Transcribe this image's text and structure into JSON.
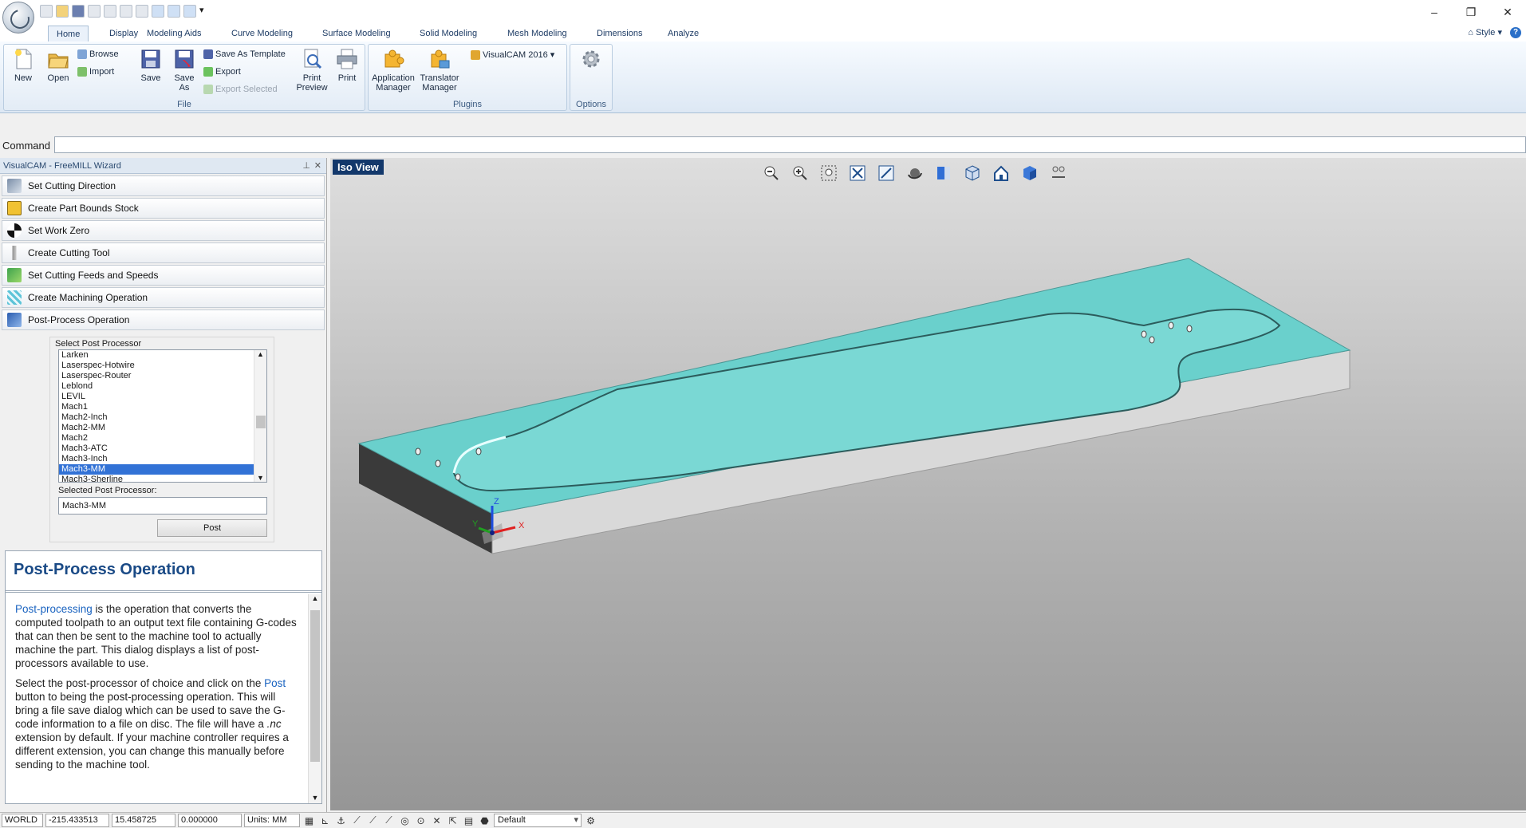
{
  "ribbon_tabs": [
    "Home",
    "Display",
    "Modeling Aids",
    "Curve Modeling",
    "Surface Modeling",
    "Solid Modeling",
    "Mesh Modeling",
    "Dimensions",
    "Analyze"
  ],
  "style_menu": "Style",
  "help_glyph": "?",
  "window_controls": {
    "minimize": "–",
    "restore": "❐",
    "close": "✕"
  },
  "file_group": {
    "label": "File",
    "new": "New",
    "open": "Open",
    "browse": "Browse",
    "import": "Import",
    "save": "Save",
    "save_as": "Save As",
    "save_as_template": "Save As Template",
    "export": "Export",
    "export_selected": "Export Selected",
    "print_preview": "Print Preview",
    "print": "Print"
  },
  "plugins_group": {
    "label": "Plugins",
    "application_manager": "Application Manager",
    "translator_manager": "Translator Manager",
    "visualcam": "VisualCAM 2016"
  },
  "options_group": {
    "label": "Options"
  },
  "command": {
    "label": "Command",
    "value": ""
  },
  "panel": {
    "title": "VisualCAM - FreeMILL Wizard",
    "pin_glyph": "⊥",
    "close_glyph": "✕",
    "wizard_items": [
      "Set Cutting Direction",
      "Create Part Bounds Stock",
      "Set Work Zero",
      "Create Cutting Tool",
      "Set Cutting Feeds and Speeds",
      "Create Machining Operation",
      "Post-Process Operation"
    ],
    "select_post_label": "Select Post Processor",
    "post_processors": [
      "Larken",
      "Laserspec-Hotwire",
      "Laserspec-Router",
      "Leblond",
      "LEVIL",
      "Mach1",
      "Mach2-Inch",
      "Mach2-MM",
      "Mach2",
      "Mach3-ATC",
      "Mach3-Inch",
      "Mach3-MM",
      "Mach3-Sherline"
    ],
    "selected_index": 11,
    "selected_label": "Selected Post Processor:",
    "selected_value": "Mach3-MM",
    "post_button": "Post"
  },
  "help": {
    "title": "Post-Process Operation",
    "p1_link": "Post-processing",
    "p1_text": " is the operation that converts the computed toolpath to an output text file containing G-codes that can then be sent to the machine tool to actually machine the part.  This dialog displays a list of post-processors available to use.",
    "p2_a": "Select the post-processor of choice and click on the ",
    "p2_link": "Post",
    "p2_b": " button to being the post-processing operation.  This will bring a file save dialog which can be used to save the G-code information to a file on disc.  The file will have a ",
    "p2_ext": ".nc",
    "p2_c": " extension by default.  If your machine controller requires a different extension, you can change this manually before sending to the machine tool."
  },
  "viewport": {
    "view_name": "Iso View",
    "axis_x": "X",
    "axis_y": "Y",
    "axis_z": "Z",
    "colors": {
      "stock_top": "#6ad0cc",
      "stock_side": "#d9d9d9",
      "stock_dark_side": "#3a3a3a"
    }
  },
  "status": {
    "coord_system": "WORLD",
    "x": "-215.433513",
    "y": "15.458725",
    "z": "0.000000",
    "units": "Units: MM",
    "layer": "Default"
  }
}
